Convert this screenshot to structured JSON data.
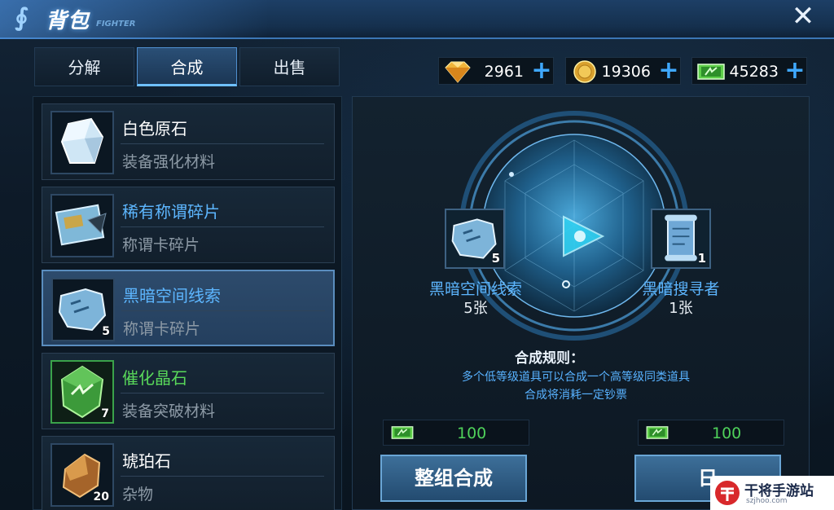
{
  "header": {
    "title": "背包",
    "subtitle": "FIGHTER",
    "close_symbol": "✕"
  },
  "tabs": [
    {
      "label": "分解",
      "active": false
    },
    {
      "label": "合成",
      "active": true
    },
    {
      "label": "出售",
      "active": false
    }
  ],
  "currencies": [
    {
      "icon": "diamond-icon",
      "value": "2961",
      "color": "#f0b43a"
    },
    {
      "icon": "gold-coin-icon",
      "value": "19306",
      "color": "#e8b83a"
    },
    {
      "icon": "banknote-icon",
      "value": "45283",
      "color": "#5fcf4a"
    }
  ],
  "plus_symbol": "+",
  "items": [
    {
      "name": "白色原石",
      "type": "装备强化材料",
      "count": "",
      "icon": "white-crystal-icon",
      "name_color": "#ffffff"
    },
    {
      "name": "稀有称谓碎片",
      "type": "称谓卡碎片",
      "count": "",
      "icon": "title-card-fragment-icon",
      "name_color": "#5db6ff"
    },
    {
      "name": "黑暗空间线索",
      "type": "称谓卡碎片",
      "count": "5",
      "icon": "dark-space-clue-icon",
      "name_color": "#5db6ff"
    },
    {
      "name": "催化晶石",
      "type": "装备突破材料",
      "count": "7",
      "icon": "catalyst-crystal-icon",
      "name_color": "#59d85a"
    },
    {
      "name": "琥珀石",
      "type": "杂物",
      "count": "20",
      "icon": "amber-stone-icon",
      "name_color": "#ffffff"
    }
  ],
  "synthesis": {
    "source": {
      "name": "黑暗空间线索",
      "qty": "5张",
      "count": "5"
    },
    "target": {
      "name": "黑暗搜寻者",
      "qty": "1张",
      "count": "1"
    },
    "rules_title": "合成规则：",
    "rules": [
      "多个低等级道具可以合成一个高等级同类道具",
      "合成将消耗一定钞票"
    ],
    "cost_left": "100",
    "cost_right": "100",
    "merge_button": "整组合成",
    "second_button": "日"
  },
  "watermark": {
    "text": "干将手游站",
    "sub": "szjhoo.com"
  }
}
